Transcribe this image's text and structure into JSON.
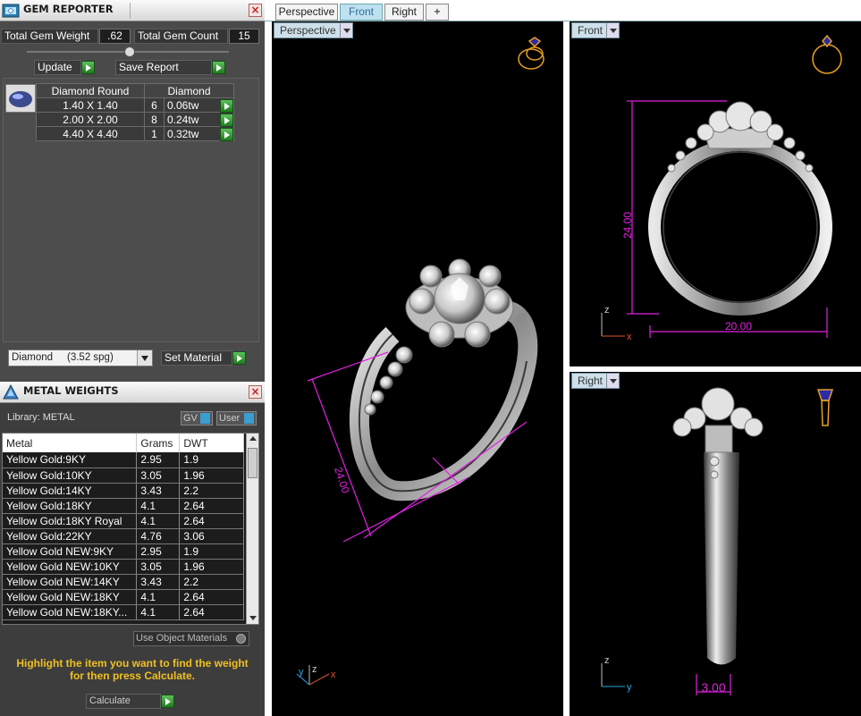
{
  "gem_reporter": {
    "title": "GEM REPORTER",
    "total_gem_weight_label": "Total Gem Weight",
    "total_gem_weight_value": ".62",
    "total_gem_count_label": "Total Gem Count",
    "total_gem_count_value": "15",
    "update_label": "Update",
    "save_report_label": "Save Report",
    "table_headers": [
      "Diamond Round",
      "Diamond"
    ],
    "rows": [
      {
        "size": "1.40 X 1.40",
        "count": "6",
        "weight": "0.06tw"
      },
      {
        "size": "2.00 X 2.00",
        "count": "8",
        "weight": "0.24tw"
      },
      {
        "size": "4.40 X 4.40",
        "count": "1",
        "weight": "0.32tw"
      }
    ],
    "material_select": "Diamond     (3.52 spg)",
    "set_material_label": "Set Material"
  },
  "metal_weights": {
    "title": "METAL WEIGHTS",
    "library_label": "Library: METAL",
    "gv_label": "GV",
    "user_label": "User",
    "columns": [
      "Metal",
      "Grams",
      "DWT"
    ],
    "rows": [
      {
        "metal": "Yellow Gold:9KY",
        "grams": "2.95",
        "dwt": "1.9"
      },
      {
        "metal": "Yellow Gold:10KY",
        "grams": "3.05",
        "dwt": "1.96"
      },
      {
        "metal": "Yellow Gold:14KY",
        "grams": "3.43",
        "dwt": "2.2"
      },
      {
        "metal": "Yellow Gold:18KY",
        "grams": "4.1",
        "dwt": "2.64"
      },
      {
        "metal": "Yellow Gold:18KY Royal",
        "grams": "4.1",
        "dwt": "2.64"
      },
      {
        "metal": "Yellow Gold:22KY",
        "grams": "4.76",
        "dwt": "3.06"
      },
      {
        "metal": "Yellow Gold NEW:9KY",
        "grams": "2.95",
        "dwt": "1.9"
      },
      {
        "metal": "Yellow Gold NEW:10KY",
        "grams": "3.05",
        "dwt": "1.96"
      },
      {
        "metal": "Yellow Gold NEW:14KY",
        "grams": "3.43",
        "dwt": "2.2"
      },
      {
        "metal": "Yellow Gold NEW:18KY",
        "grams": "4.1",
        "dwt": "2.64"
      },
      {
        "metal": "Yellow Gold NEW:18KY...",
        "grams": "4.1",
        "dwt": "2.64"
      }
    ],
    "use_object_materials_label": "Use Object Materials",
    "hint_text": "Highlight the item you want to find the weight for then press Calculate.",
    "calculate_label": "Calculate"
  },
  "viewports": {
    "tabs": [
      "Perspective",
      "Front",
      "Right"
    ],
    "active_tab": "Front",
    "perspective_label": "Perspective",
    "front_label": "Front",
    "right_label": "Right",
    "persp_dim": "24.00",
    "front_height_dim": "24.00",
    "front_width_dim": "20.00",
    "right_width_dim": "3.00",
    "axis_x": "x",
    "axis_y": "y",
    "axis_z": "z"
  },
  "colors": {
    "dimension": "#e020e0",
    "axis_x": "#e05030",
    "axis_y": "#30a0e0",
    "hint": "#f0c020"
  }
}
